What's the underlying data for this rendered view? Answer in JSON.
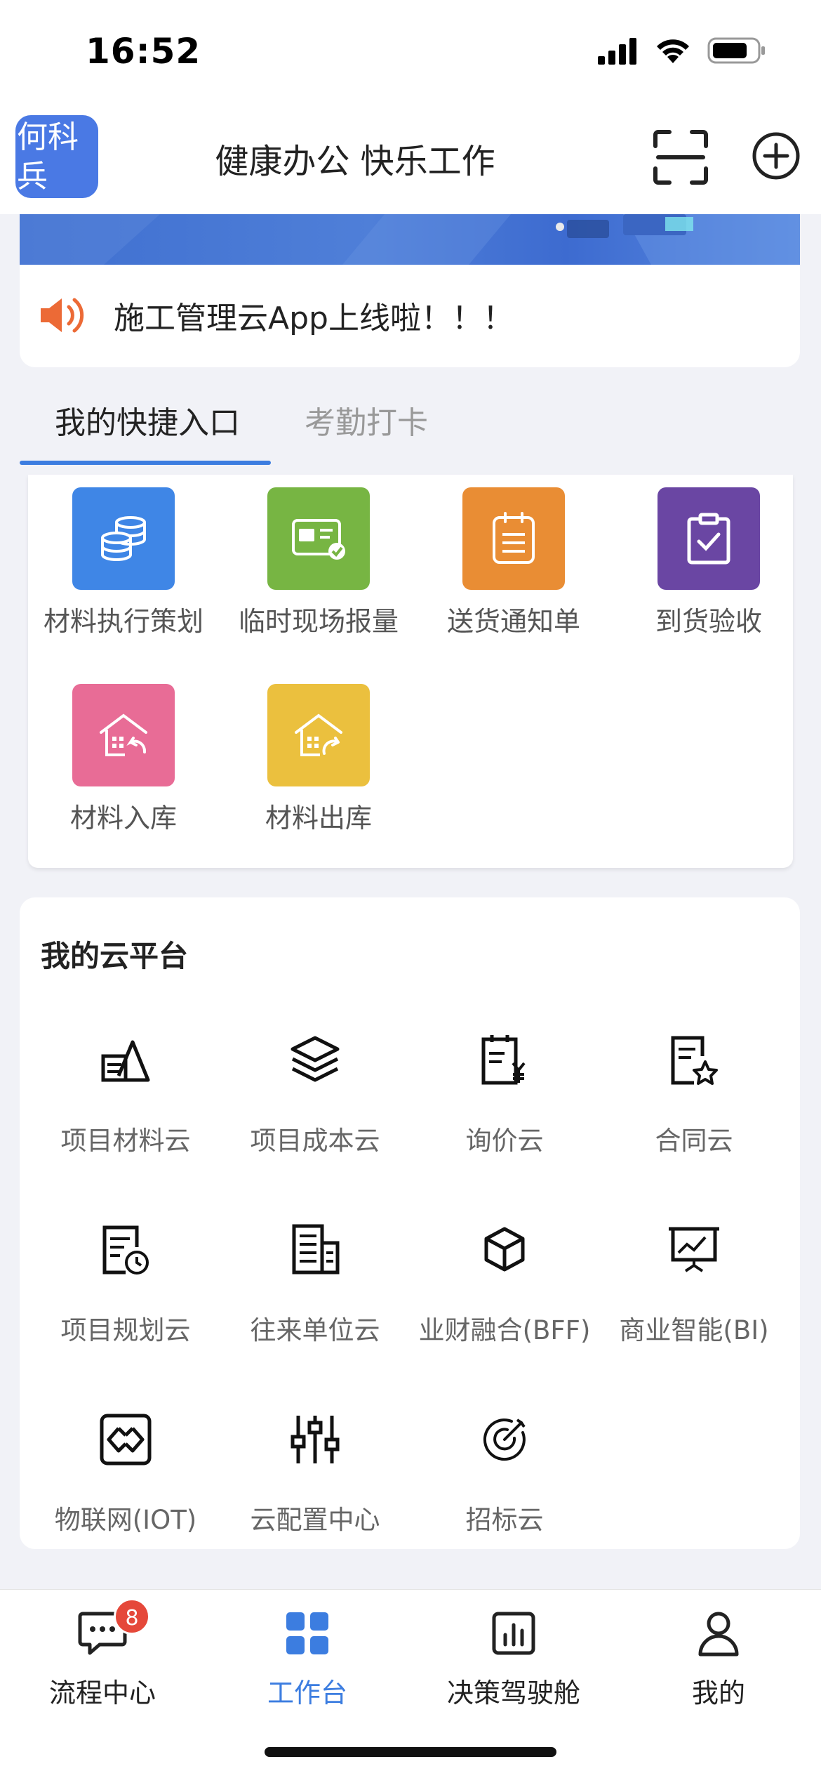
{
  "status_bar": {
    "time": "16:52"
  },
  "header": {
    "avatar_text": "何科兵",
    "title": "健康办公 快乐工作"
  },
  "notice": {
    "text": "施工管理云App上线啦！！！"
  },
  "tabs": [
    {
      "label": "我的快捷入口"
    },
    {
      "label": "考勤打卡"
    }
  ],
  "quick_entries": [
    {
      "label": "材料执行策划",
      "color": "#3f86e6",
      "icon": "coins-stack-icon"
    },
    {
      "label": "临时现场报量",
      "color": "#77b543",
      "icon": "temp-card-icon"
    },
    {
      "label": "送货通知单",
      "color": "#e98d34",
      "icon": "notepad-icon"
    },
    {
      "label": "到货验收",
      "color": "#6a46a3",
      "icon": "clipboard-check-icon"
    },
    {
      "label": "材料入库",
      "color": "#e86c96",
      "icon": "warehouse-in-icon"
    },
    {
      "label": "材料出库",
      "color": "#ebc03e",
      "icon": "warehouse-out-icon"
    }
  ],
  "cloud_platform": {
    "title": "我的云平台",
    "items": [
      {
        "label": "项目材料云",
        "icon": "material-cloud-icon"
      },
      {
        "label": "项目成本云",
        "icon": "layers-icon"
      },
      {
        "label": "询价云",
        "icon": "price-inquiry-icon"
      },
      {
        "label": "合同云",
        "icon": "contract-star-icon"
      },
      {
        "label": "项目规划云",
        "icon": "plan-clock-icon"
      },
      {
        "label": "往来单位云",
        "icon": "building-icon"
      },
      {
        "label": "业财融合(BFF)",
        "icon": "cube-icon"
      },
      {
        "label": "商业智能(BI)",
        "icon": "bi-board-icon"
      },
      {
        "label": "物联网(IOT)",
        "icon": "iot-link-icon"
      },
      {
        "label": "云配置中心",
        "icon": "sliders-icon"
      },
      {
        "label": "招标云",
        "icon": "target-icon"
      }
    ]
  },
  "bottom_nav": {
    "items": [
      {
        "label": "流程中心",
        "icon": "chat-bubble-icon"
      },
      {
        "label": "工作台",
        "icon": "grid-icon"
      },
      {
        "label": "决策驾驶舱",
        "icon": "bar-chart-icon"
      },
      {
        "label": "我的",
        "icon": "person-icon"
      }
    ],
    "badge_count": "8",
    "active_color": "#3c7de0"
  }
}
